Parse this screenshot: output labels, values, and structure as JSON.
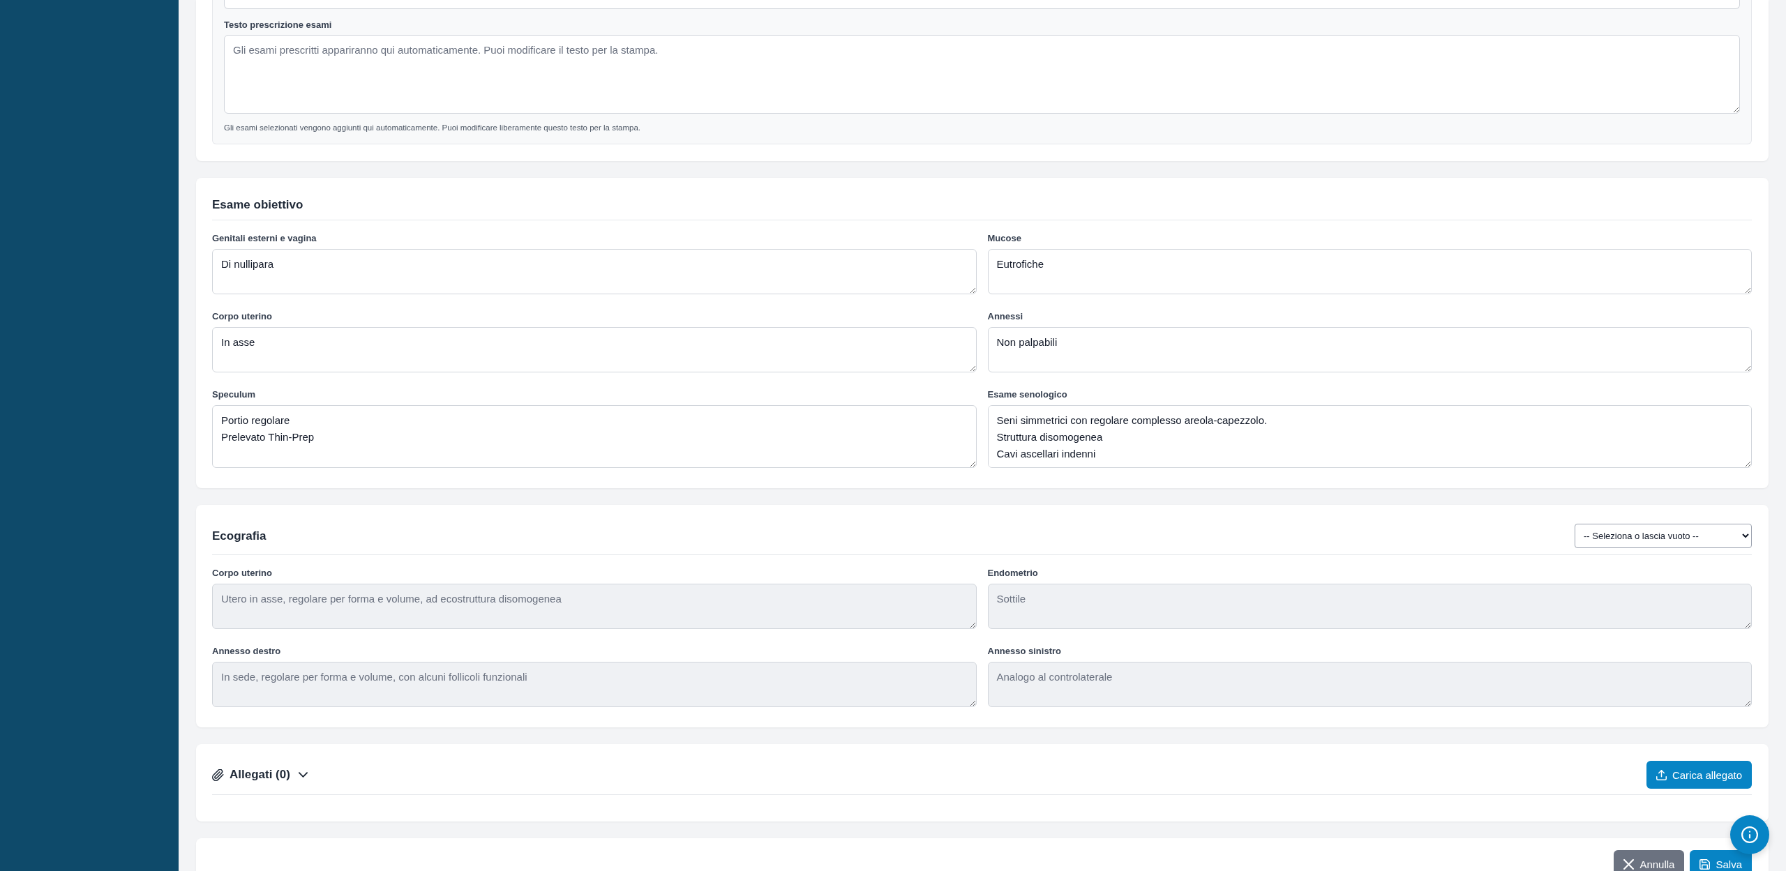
{
  "prescription": {
    "label": "Testo prescrizione esami",
    "placeholder": "Gli esami prescritti appariranno qui automaticamente. Puoi modificare il testo per la stampa.",
    "help": "Gli esami selezionati vengono aggiunti qui automaticamente. Puoi modificare liberamente questo testo per la stampa."
  },
  "esame_obiettivo": {
    "title": "Esame obiettivo",
    "fields": [
      {
        "label": "Genitali esterni e vagina",
        "value": "Di nullipara",
        "disabled": false
      },
      {
        "label": "Mucose",
        "value": "Eutrofiche",
        "disabled": false
      },
      {
        "label": "Corpo uterino",
        "value": "In asse",
        "disabled": false
      },
      {
        "label": "Annessi",
        "value": "Non palpabili",
        "disabled": false
      },
      {
        "label": "Speculum",
        "value": "Portio regolare\nPrelevato Thin-Prep",
        "disabled": false
      },
      {
        "label": "Esame senologico",
        "value": "Seni simmetrici con regolare complesso areola-capezzolo.\nStruttura disomogenea\nCavi ascellari indenni",
        "disabled": false
      }
    ]
  },
  "ecografia": {
    "title": "Ecografia",
    "select": {
      "value": "-- Seleziona o lascia vuoto --"
    },
    "fields": [
      {
        "label": "Corpo uterino",
        "placeholder": "Utero in asse, regolare per forma e volume, ad ecostruttura disomogenea",
        "disabled": true
      },
      {
        "label": "Endometrio",
        "placeholder": "Sottile",
        "disabled": true
      },
      {
        "label": "Annesso destro",
        "placeholder": "In sede, regolare per forma e volume, con alcuni follicoli funzionali",
        "disabled": true
      },
      {
        "label": "Annesso sinistro",
        "placeholder": "Analogo al controlaterale",
        "disabled": true
      }
    ]
  },
  "allegati": {
    "title": "Allegati (0)",
    "upload_button": "Carica allegato"
  },
  "footer": {
    "buttons": [
      {
        "label": "Annulla",
        "kind": "cancel"
      },
      {
        "label": "Salva",
        "kind": "save"
      }
    ]
  }
}
